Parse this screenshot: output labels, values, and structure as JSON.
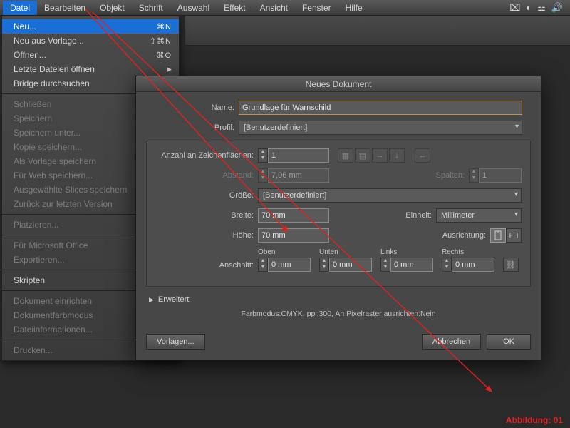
{
  "menubar": {
    "items": [
      "Datei",
      "Bearbeiten",
      "Objekt",
      "Schrift",
      "Auswahl",
      "Effekt",
      "Ansicht",
      "Fenster",
      "Hilfe"
    ]
  },
  "dropdown": {
    "groups": [
      [
        {
          "label": "Neu...",
          "shortcut": "⌘N",
          "selected": true
        },
        {
          "label": "Neu aus Vorlage...",
          "shortcut": "⇧⌘N"
        },
        {
          "label": "Öffnen...",
          "shortcut": "⌘O"
        },
        {
          "label": "Letzte Dateien öffnen",
          "submenu": true
        },
        {
          "label": "Bridge durchsuchen",
          "shortcut": ""
        }
      ],
      [
        {
          "label": "Schließen",
          "disabled": true
        },
        {
          "label": "Speichern",
          "disabled": true
        },
        {
          "label": "Speichern unter...",
          "disabled": true
        },
        {
          "label": "Kopie speichern...",
          "disabled": true
        },
        {
          "label": "Als Vorlage speichern",
          "disabled": true
        },
        {
          "label": "Für Web speichern...",
          "disabled": true
        },
        {
          "label": "Ausgewählte Slices speichern",
          "disabled": true
        },
        {
          "label": "Zurück zur letzten Version",
          "disabled": true
        }
      ],
      [
        {
          "label": "Platzieren...",
          "disabled": true
        }
      ],
      [
        {
          "label": "Für Microsoft Office",
          "disabled": true
        },
        {
          "label": "Exportieren...",
          "disabled": true
        }
      ],
      [
        {
          "label": "Skripten"
        }
      ],
      [
        {
          "label": "Dokument einrichten",
          "disabled": true
        },
        {
          "label": "Dokumentfarbmodus",
          "disabled": true
        },
        {
          "label": "Dateiinformationen...",
          "disabled": true
        }
      ],
      [
        {
          "label": "Drucken...",
          "disabled": true
        }
      ]
    ]
  },
  "dialog": {
    "title": "Neues Dokument",
    "labels": {
      "name": "Name:",
      "profil": "Profil:",
      "artboards": "Anzahl an Zeichenflächen:",
      "abstand": "Abstand:",
      "spalten": "Spalten:",
      "groesse": "Größe:",
      "breite": "Breite:",
      "einheit": "Einheit:",
      "hoehe": "Höhe:",
      "ausrichtung": "Ausrichtung:",
      "anschnitt": "Anschnitt:",
      "oben": "Oben",
      "unten": "Unten",
      "links": "Links",
      "rechts": "Rechts",
      "erweitert": "Erweitert"
    },
    "values": {
      "name": "Grundlage für Warnschild",
      "profil": "[Benutzerdefiniert]",
      "artboards": "1",
      "abstand": "7,06 mm",
      "spalten": "1",
      "groesse": "[Benutzerdefiniert]",
      "breite": "70 mm",
      "hoehe": "70 mm",
      "einheit": "Millimeter",
      "bleed": "0 mm"
    },
    "info": "Farbmodus:CMYK, ppi:300, An Pixelraster ausrichten:Nein",
    "buttons": {
      "vorlagen": "Vorlagen...",
      "abbrechen": "Abbrechen",
      "ok": "OK"
    }
  },
  "annotation": "Abbildung: 01"
}
